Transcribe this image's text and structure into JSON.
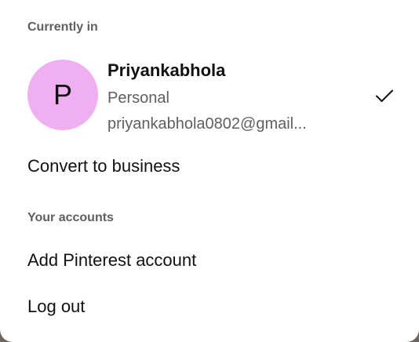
{
  "menu": {
    "currently_in_label": "Currently in",
    "account": {
      "avatar_initial": "P",
      "name": "Priyankabhola",
      "type": "Personal",
      "email": "priyankabhola0802@gmail...",
      "selected_icon": "checkmark-icon",
      "avatar_color": "#efaff0"
    },
    "convert_label": "Convert to business",
    "your_accounts_label": "Your accounts",
    "add_account_label": "Add Pinterest account",
    "logout_label": "Log out"
  }
}
